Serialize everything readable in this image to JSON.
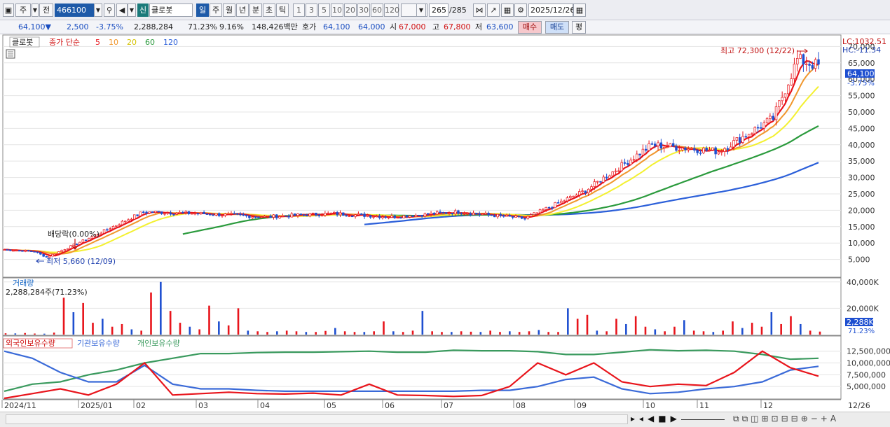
{
  "toolbar": {
    "type_label": "주",
    "prev_label": "전",
    "code": "466100",
    "badge": "신",
    "name": "클로봇",
    "periods": [
      "일",
      "주",
      "월",
      "년",
      "분",
      "초",
      "틱"
    ],
    "intervals": [
      "1",
      "3",
      "5",
      "10",
      "20",
      "30",
      "60",
      "120"
    ],
    "count": "265",
    "total": "/285",
    "date": "2025/12/26"
  },
  "quote": {
    "price": "64,100▼",
    "change": "2,500",
    "change_pct": "-3.75%",
    "volume": "2,288,284",
    "vol_ratio": "71.23%",
    "turnover": "9.16%",
    "amount": "148,426백만",
    "ask_label": "호가",
    "ask": "64,100",
    "bid": "64,000",
    "open_label": "시",
    "open": "67,000",
    "high_label": "고",
    "high": "67,800",
    "low_label": "저",
    "low": "63,600",
    "buy_label": "매수",
    "sell_label": "매도",
    "eval_label": "평"
  },
  "colors": {
    "ma5": "#e8141b",
    "ma10": "#f0962c",
    "ma20": "#f3f030",
    "ma60": "#2a9a3c",
    "ma120": "#2b5fd9",
    "up": "#e8141b",
    "down": "#1e4fd0",
    "foreign": "#e8141b",
    "inst": "#3a6ad8",
    "indiv": "#3a9a5e"
  },
  "chart_data": [
    {
      "type": "candlestick",
      "name": "클로봇",
      "legend": [
        "종가 단순",
        "5",
        "10",
        "20",
        "60",
        "120"
      ],
      "x_ticks": [
        "2024/11",
        "2025/01",
        "02",
        "03",
        "04",
        "05",
        "06",
        "07",
        "08",
        "09",
        "10",
        "11",
        "12",
        "12/26"
      ],
      "y_ticks": [
        "5,000",
        "10,000",
        "15,000",
        "20,000",
        "25,000",
        "30,000",
        "35,000",
        "40,000",
        "45,000",
        "50,000",
        "55,000",
        "60,000",
        "65,000",
        "70,000"
      ],
      "ylim": [
        0,
        72000
      ],
      "annotations": {
        "high": "최고 72,300 (12/22)",
        "low": "최저 5,660 (12/09)",
        "dividend": "배당락(0.00%)",
        "lc": "LC:1032.51",
        "hc": "HC:-11.34",
        "last": "64,100",
        "last_pct": "-3.75%"
      },
      "points": [
        {
          "d": "2024/11",
          "c": 8000
        },
        {
          "d": "2024/12",
          "c": 7400
        },
        {
          "d": "2024/12/09",
          "c": 5660
        },
        {
          "d": "2025/01",
          "c": 11500
        },
        {
          "d": "2025/02",
          "c": 19500
        },
        {
          "d": "2025/03",
          "c": 19000
        },
        {
          "d": "2025/04",
          "c": 18000
        },
        {
          "d": "2025/05",
          "c": 19000
        },
        {
          "d": "2025/06",
          "c": 18000
        },
        {
          "d": "2025/07",
          "c": 19500
        },
        {
          "d": "2025/08",
          "c": 17500
        },
        {
          "d": "2025/09",
          "c": 26000
        },
        {
          "d": "2025/10",
          "c": 40000
        },
        {
          "d": "2025/11",
          "c": 38000
        },
        {
          "d": "2025/12",
          "c": 48000
        },
        {
          "d": "2025/12/22",
          "c": 66000,
          "h": 72300
        },
        {
          "d": "2025/12/26",
          "c": 64100
        }
      ]
    },
    {
      "type": "bar",
      "name": "거래량",
      "info": "2,288,284주(71.23%)",
      "y_ticks": [
        "20,000K",
        "40,000K"
      ],
      "ylim": [
        0,
        42000
      ],
      "last": "2,288K",
      "last_pct": "71.23%",
      "values_k": [
        1000,
        900,
        1200,
        800,
        700,
        1500,
        28000,
        17000,
        24000,
        9000,
        12000,
        6000,
        8000,
        4000,
        3000,
        32000,
        40000,
        18000,
        9000,
        6000,
        4000,
        22000,
        10000,
        7000,
        20000,
        3000,
        2500,
        2000,
        2500,
        3000,
        2500,
        2000,
        2000,
        2800,
        5000,
        2500,
        2000,
        2000,
        2500,
        10000,
        2500,
        2000,
        3000,
        18000,
        2500,
        2000,
        2000,
        2500,
        2200,
        2000,
        3000,
        2000,
        2500,
        2000,
        2500,
        3500,
        2000,
        2000,
        20000,
        12000,
        15000,
        3000,
        2500,
        12000,
        8000,
        14000,
        6000,
        4000,
        2500,
        6000,
        11000,
        3000,
        2500,
        2000,
        3000,
        10000,
        5000,
        9000,
        6000,
        17000,
        8000,
        14000,
        8000,
        3000,
        2288
      ]
    },
    {
      "type": "line",
      "name": "보유수량",
      "series": [
        {
          "name": "외국인보유수량",
          "values": [
            2500000,
            3500000,
            4500000,
            3200000,
            5500000,
            10000000,
            3200000,
            3500000,
            3800000,
            3500000,
            3400000,
            3600000,
            3200000,
            5500000,
            3200000,
            3100000,
            2900000,
            3100000,
            5000000,
            10000000,
            7500000,
            10000000,
            6000000,
            5000000,
            5500000,
            5200000,
            8000000,
            12500000,
            9000000,
            7200000
          ]
        },
        {
          "name": "기관보유수량",
          "values": [
            12500000,
            11000000,
            8000000,
            6000000,
            6000000,
            9500000,
            5500000,
            4500000,
            4500000,
            4200000,
            4000000,
            4000000,
            4000000,
            4000000,
            4000000,
            4000000,
            4000000,
            4200000,
            4200000,
            5000000,
            6500000,
            7000000,
            4500000,
            3500000,
            3800000,
            4500000,
            5000000,
            6000000,
            8500000,
            9300000
          ]
        },
        {
          "name": "개인보유수량",
          "values": [
            4000000,
            5500000,
            6000000,
            7500000,
            8500000,
            10000000,
            11000000,
            12000000,
            12000000,
            12200000,
            12300000,
            12300000,
            12400000,
            12500000,
            12300000,
            12300000,
            12700000,
            12600000,
            12600000,
            12400000,
            11800000,
            11800000,
            12300000,
            12800000,
            12600000,
            12700000,
            12500000,
            11800000,
            10800000,
            11000000
          ]
        }
      ],
      "y_ticks": [
        "5,000,000",
        "7,500,000",
        "10,000,000",
        "12,500,000"
      ],
      "ylim": [
        2500000,
        13500000
      ]
    }
  ]
}
